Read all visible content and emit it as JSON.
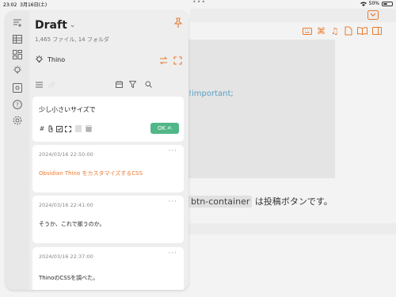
{
  "status_bar": {
    "time": "23:02",
    "date": "3月16日(土)",
    "battery": "50%",
    "battery_level": 0.5,
    "dots": "•••"
  },
  "background": {
    "important_text": "!important;",
    "bottom_code": "btn-container",
    "bottom_text": "は投稿ボタンです。"
  },
  "panel": {
    "title": "Draft",
    "counts": "1,465 ファイル, 14 フォルダ",
    "thino_label": "Thino",
    "editor": {
      "text": "少し小さいサイズで",
      "ok_label": "OK"
    },
    "memos": [
      {
        "timestamp": "2024/03/16 22:50:00",
        "content": "Obsidian Thino をカスタマイズするCSS",
        "accent": true
      },
      {
        "timestamp": "2024/03/16 22:41:00",
        "content": "そうか、これで揃うのか。",
        "accent": false
      },
      {
        "timestamp": "2024/03/16 22:37:00",
        "content": "ThinoのCSSを調べた。",
        "accent": false
      }
    ],
    "more_label": "···"
  },
  "colors": {
    "accent": "#e9792c",
    "ok_green": "#52b788",
    "link_blue": "#5aa0c8"
  }
}
